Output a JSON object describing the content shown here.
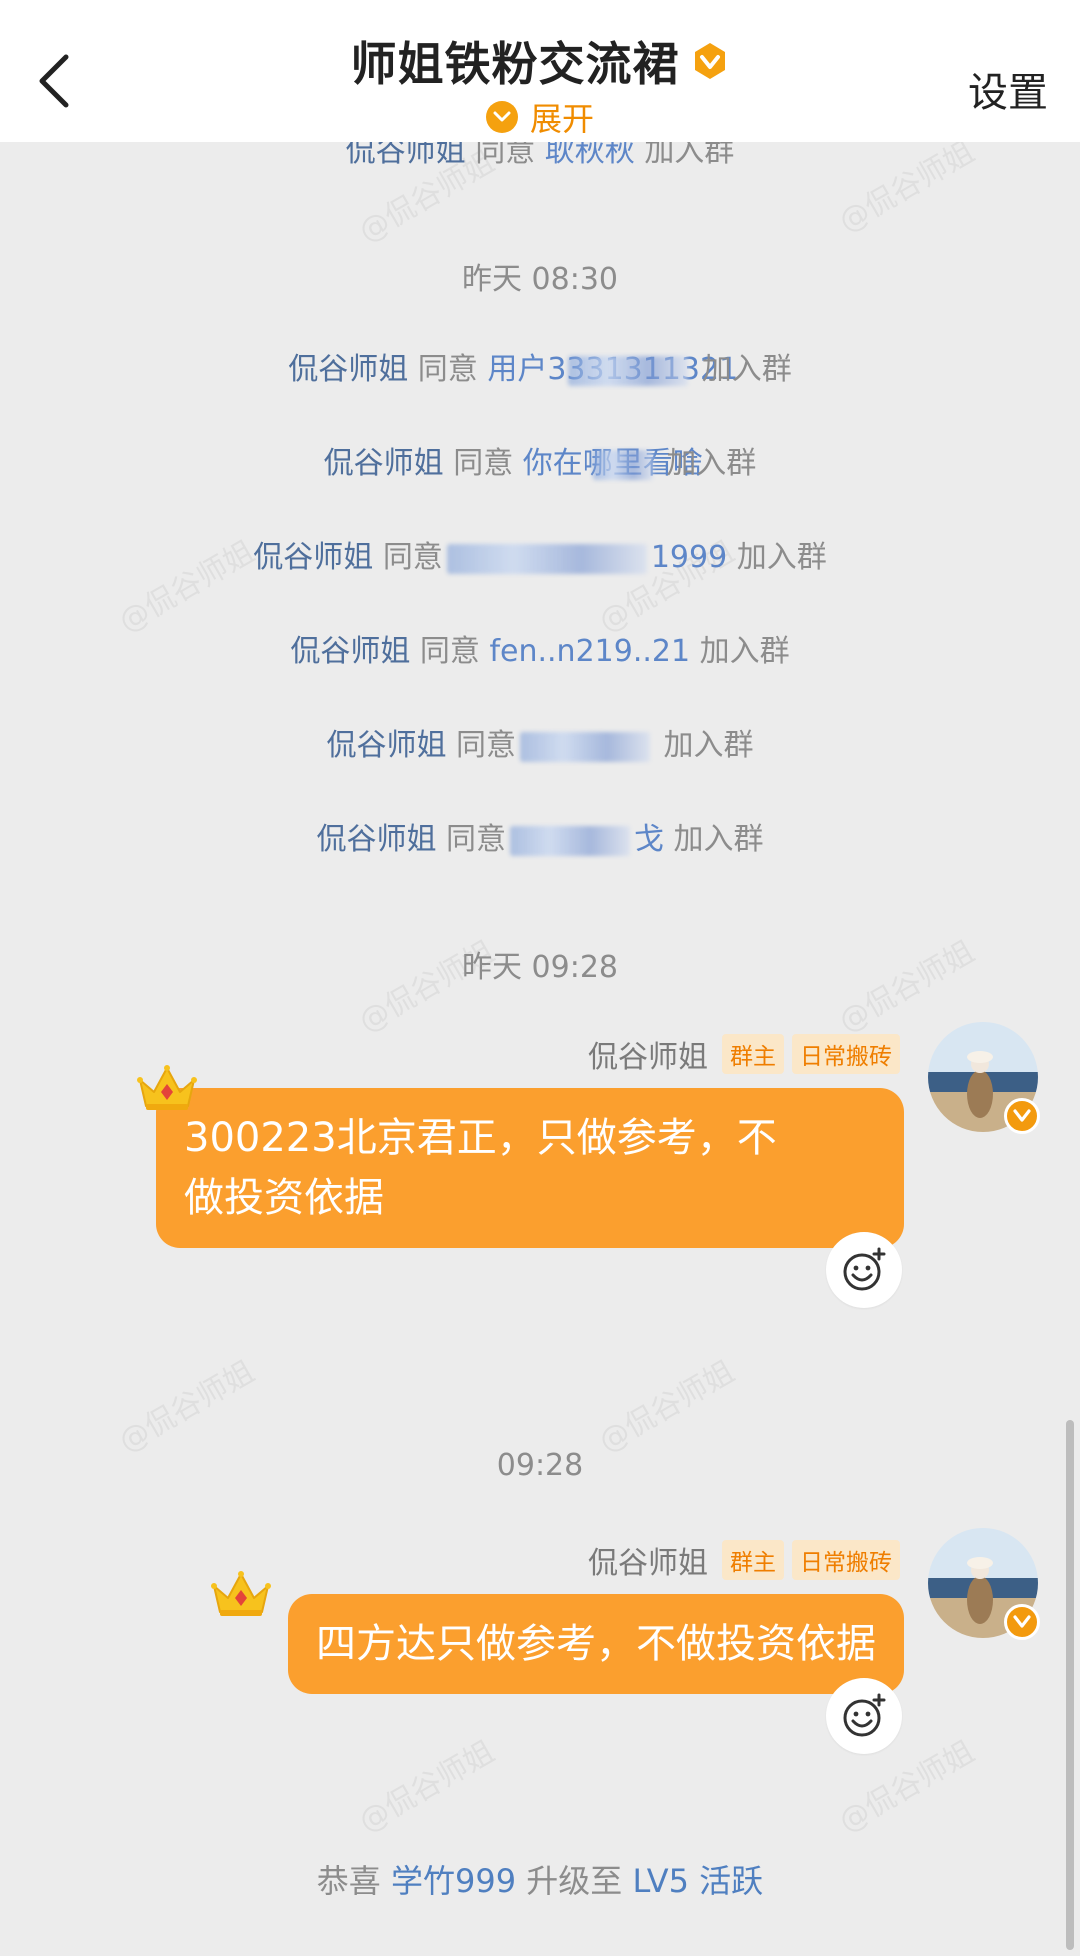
{
  "header": {
    "back_icon": "chevron-left-icon",
    "title": "师姐铁粉交流裙",
    "verified_icon": "verified-v-icon",
    "expand_label": "展开",
    "settings_label": "设置"
  },
  "cut_line": {
    "actor": "侃谷师姐",
    "verb": "同意",
    "target": "耿秋秋",
    "suffix": "加入群"
  },
  "section1": {
    "timestamp": "昨天 08:30",
    "events": [
      {
        "actor": "侃谷师姐",
        "verb": "同意",
        "target": "用户3331311321",
        "suffix": "加入群"
      },
      {
        "actor": "侃谷师姐",
        "verb": "同意",
        "target": "你在哪里看啥",
        "suffix": "加入群"
      },
      {
        "actor": "侃谷师姐",
        "verb": "同意",
        "target": "1999",
        "suffix": "加入群"
      },
      {
        "actor": "侃谷师姐",
        "verb": "同意",
        "target": "fen..n219..21",
        "suffix": "加入群"
      },
      {
        "actor": "侃谷师姐",
        "verb": "同意",
        "target": "",
        "suffix": "加入群"
      },
      {
        "actor": "侃谷师姐",
        "verb": "同意",
        "target": "戈",
        "suffix": "加入群"
      }
    ]
  },
  "section2": {
    "timestamp": "昨天 09:28",
    "message": {
      "sender": "侃谷师姐",
      "tags": [
        "群主",
        "日常搬砖"
      ],
      "text_line1": "300223北京君正，只做参考，不",
      "text_line2": "做投资依据"
    }
  },
  "section3": {
    "timestamp": "09:28",
    "message": {
      "sender": "侃谷师姐",
      "tags": [
        "群主",
        "日常搬砖"
      ],
      "text": "四方达只做参考，不做投资依据"
    }
  },
  "bottom_notice": {
    "prefix": "恭喜",
    "user": "学竹999",
    "middle": "升级至",
    "level": "LV5 活跃"
  },
  "watermark_text": "@侃谷师姐",
  "colors": {
    "accent": "#fb9f2e",
    "link_blue": "#4f6f9c",
    "background": "#ececec"
  }
}
